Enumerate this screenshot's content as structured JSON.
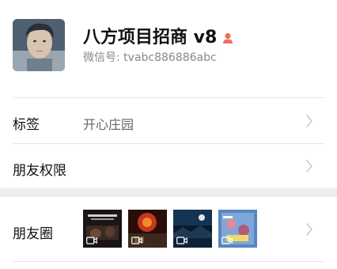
{
  "profile": {
    "name": "八方项目招商 v8",
    "wechat_id_label": "微信号:",
    "wechat_id": "tvabc886886abc"
  },
  "rows": [
    {
      "label": "标签",
      "value": "开心庄园"
    },
    {
      "label": "朋友权限",
      "value": ""
    },
    {
      "label": "朋友圈",
      "value": ""
    }
  ],
  "icons": {
    "gender": "person-icon",
    "chevron": "chevron-right-icon",
    "video": "video-icon"
  },
  "colors": {
    "gender_icon": "#f26d5b",
    "chevron": "#c8c8c8",
    "divider": "#e7e7e7"
  }
}
